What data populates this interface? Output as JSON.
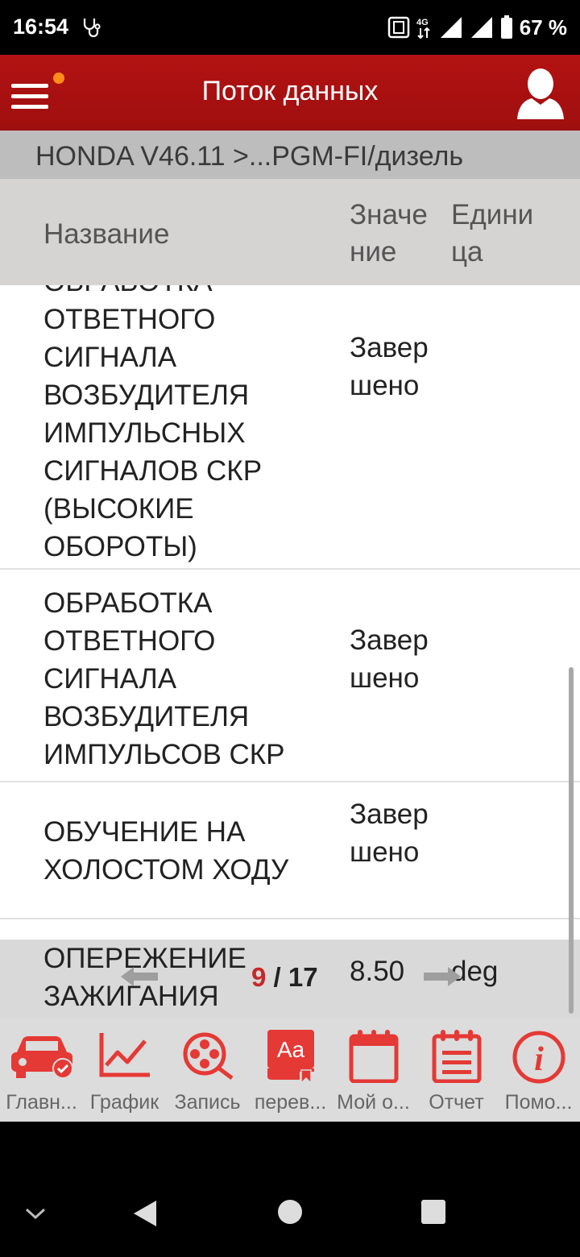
{
  "status_bar": {
    "time": "16:54",
    "network": "4G",
    "battery": "67 %",
    "icons": [
      "stethoscope-icon",
      "nfc-icon",
      "signal-icon",
      "signal-icon",
      "battery-icon"
    ]
  },
  "app_bar": {
    "title": "Поток данных",
    "menu_icon": "hamburger-menu-icon",
    "user_icon": "user-avatar-icon",
    "notification_dot_color": "#ff8c1a",
    "color": "#b31212"
  },
  "breadcrumb": "HONDA V46.11 >...PGM-FI/дизель",
  "table": {
    "columns": {
      "name": "Название",
      "value": "Значение",
      "unit": "Единица"
    },
    "rows": [
      {
        "name": "ОБРАБОТКА ОТВЕТНОГО СИГНАЛА ВОЗБУДИТЕЛЯ ИМПУЛЬСНЫХ СИГНАЛОВ СКР (ВЫСОКИЕ ОБОРОТЫ)",
        "value": "Завершено",
        "unit": ""
      },
      {
        "name": "ОБРАБОТКА ОТВЕТНОГО СИГНАЛА ВОЗБУДИТЕЛЯ ИМПУЛЬСОВ СКР",
        "value": "Завершено",
        "unit": ""
      },
      {
        "name": "ОБУЧЕНИЕ НА ХОЛОСТОМ ХОДУ",
        "value": "Завершено",
        "unit": ""
      },
      {
        "name": "ОПЕРЕЖЕНИЕ ЗАЖИГАНИЯ",
        "value": "8.50",
        "unit": "deg"
      }
    ]
  },
  "pager": {
    "current": "9",
    "separator": " / ",
    "total": "17"
  },
  "toolbar": {
    "accent": "#e53935",
    "items": [
      {
        "label": "Главн...",
        "icon": "car-check-icon"
      },
      {
        "label": "График",
        "icon": "line-chart-icon"
      },
      {
        "label": "Запись",
        "icon": "film-reel-icon"
      },
      {
        "label": "перев...",
        "icon": "translate-icon"
      },
      {
        "label": "Мой о...",
        "icon": "calendar-icon"
      },
      {
        "label": "Отчет",
        "icon": "report-icon"
      },
      {
        "label": "Помо...",
        "icon": "info-icon"
      }
    ]
  },
  "system_nav": {
    "icons": [
      "chevron-down-icon",
      "back-icon",
      "home-icon",
      "recents-icon"
    ]
  }
}
